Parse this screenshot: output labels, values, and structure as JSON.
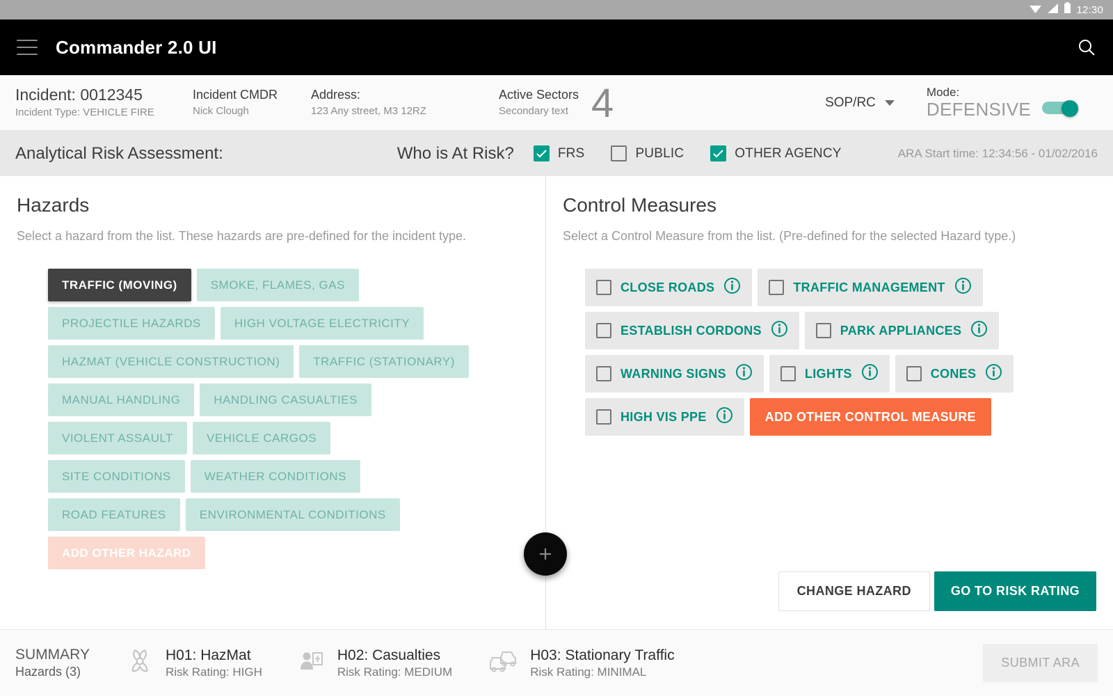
{
  "statusbar": {
    "time": "12:30",
    "icons": [
      "wifi-icon",
      "signal-icon",
      "battery-icon"
    ]
  },
  "appbar": {
    "title": "Commander 2.0 UI",
    "menu_icon": "hamburger-menu-icon",
    "search_icon": "search-icon"
  },
  "incident": {
    "id_label": "Incident: 0012345",
    "type_label": "Incident Type: VEHICLE FIRE",
    "cmdr_label": "Incident CMDR",
    "cmdr_name": "Nick Clough",
    "address_label": "Address:",
    "address_value": "123 Any street, M3 12RZ",
    "sectors_label": "Active Sectors",
    "sectors_secondary": "Secondary text",
    "sectors_count": "4",
    "sop_label": "SOP/RC",
    "mode_label": "Mode:",
    "mode_value": "DEFENSIVE",
    "mode_on": true
  },
  "ara": {
    "title": "Analytical Risk Assessment:",
    "who_label": "Who is At Risk?",
    "options": [
      {
        "label": "FRS",
        "checked": true
      },
      {
        "label": "PUBLIC",
        "checked": false
      },
      {
        "label": "OTHER AGENCY",
        "checked": true
      }
    ],
    "start_time": "ARA Start time: 12:34:56 - 01/02/2016"
  },
  "hazards": {
    "title": "Hazards",
    "subtitle": "Select a hazard from the list. These hazards are pre-defined for the incident type.",
    "rows": [
      [
        {
          "label": "TRAFFIC (MOVING)",
          "state": "selected"
        },
        {
          "label": "SMOKE, FLAMES, GAS",
          "state": "normal"
        }
      ],
      [
        {
          "label": "PROJECTILE HAZARDS",
          "state": "normal"
        },
        {
          "label": "HIGH VOLTAGE ELECTRICITY",
          "state": "normal"
        }
      ],
      [
        {
          "label": "HAZMAT (VEHICLE CONSTRUCTION)",
          "state": "normal"
        },
        {
          "label": "TRAFFIC (STATIONARY)",
          "state": "normal"
        }
      ],
      [
        {
          "label": "MANUAL HANDLING",
          "state": "normal"
        },
        {
          "label": "HANDLING CASUALTIES",
          "state": "normal"
        }
      ],
      [
        {
          "label": "VIOLENT ASSAULT",
          "state": "normal"
        },
        {
          "label": "VEHICLE CARGOS",
          "state": "normal"
        }
      ],
      [
        {
          "label": "SITE CONDITIONS",
          "state": "normal"
        },
        {
          "label": "WEATHER CONDITIONS",
          "state": "normal"
        }
      ],
      [
        {
          "label": "ROAD FEATURES",
          "state": "normal"
        },
        {
          "label": "ENVIRONMENTAL CONDITIONS",
          "state": "normal"
        }
      ],
      [
        {
          "label": "ADD OTHER  HAZARD",
          "state": "addother"
        }
      ]
    ]
  },
  "control_measures": {
    "title": "Control Measures",
    "subtitle": "Select a Control Measure from the list. (Pre-defined for the selected Hazard type.)",
    "rows": [
      [
        {
          "label": "CLOSE ROADS",
          "checked": false,
          "info": true
        },
        {
          "label": "TRAFFIC MANAGEMENT",
          "checked": false,
          "info": true
        }
      ],
      [
        {
          "label": "ESTABLISH CORDONS",
          "checked": false,
          "info": true
        },
        {
          "label": "PARK APPLIANCES",
          "checked": false,
          "info": true
        }
      ],
      [
        {
          "label": "WARNING SIGNS",
          "checked": false,
          "info": true
        },
        {
          "label": "LIGHTS",
          "checked": false,
          "info": true
        },
        {
          "label": "CONES",
          "checked": false,
          "info": true
        }
      ],
      [
        {
          "label": "HIGH VIS PPE",
          "checked": false,
          "info": true
        },
        {
          "label": "ADD OTHER  CONTROL MEASURE",
          "state": "addother"
        }
      ]
    ],
    "change_hazard_label": "CHANGE HAZARD",
    "go_to_risk_rating_label": "GO TO RISK RATING"
  },
  "fab": {
    "icon": "plus-icon"
  },
  "summary": {
    "head_title": "SUMMARY",
    "head_sub": "Hazards (3)",
    "items": [
      {
        "icon": "biohazard-icon",
        "name": "H01: HazMat",
        "rating": "Risk Rating: HIGH"
      },
      {
        "icon": "casualty-icon",
        "name": "H02: Casualties",
        "rating": "Risk Rating: MEDIUM"
      },
      {
        "icon": "traffic-cars-icon",
        "name": "H03: Stationary Traffic",
        "rating": "Risk Rating: MINIMAL"
      }
    ],
    "submit_label": "SUBMIT ARA"
  },
  "colors": {
    "accent_teal": "#00897b",
    "chip_teal_bg": "#c8e6e0",
    "chip_teal_text": "#6fb3a8",
    "add_other_hazard": "#fbd9cf",
    "add_other_cm": "#f96c3f",
    "selected_chip": "#424242",
    "cm_text": "#00907c"
  }
}
